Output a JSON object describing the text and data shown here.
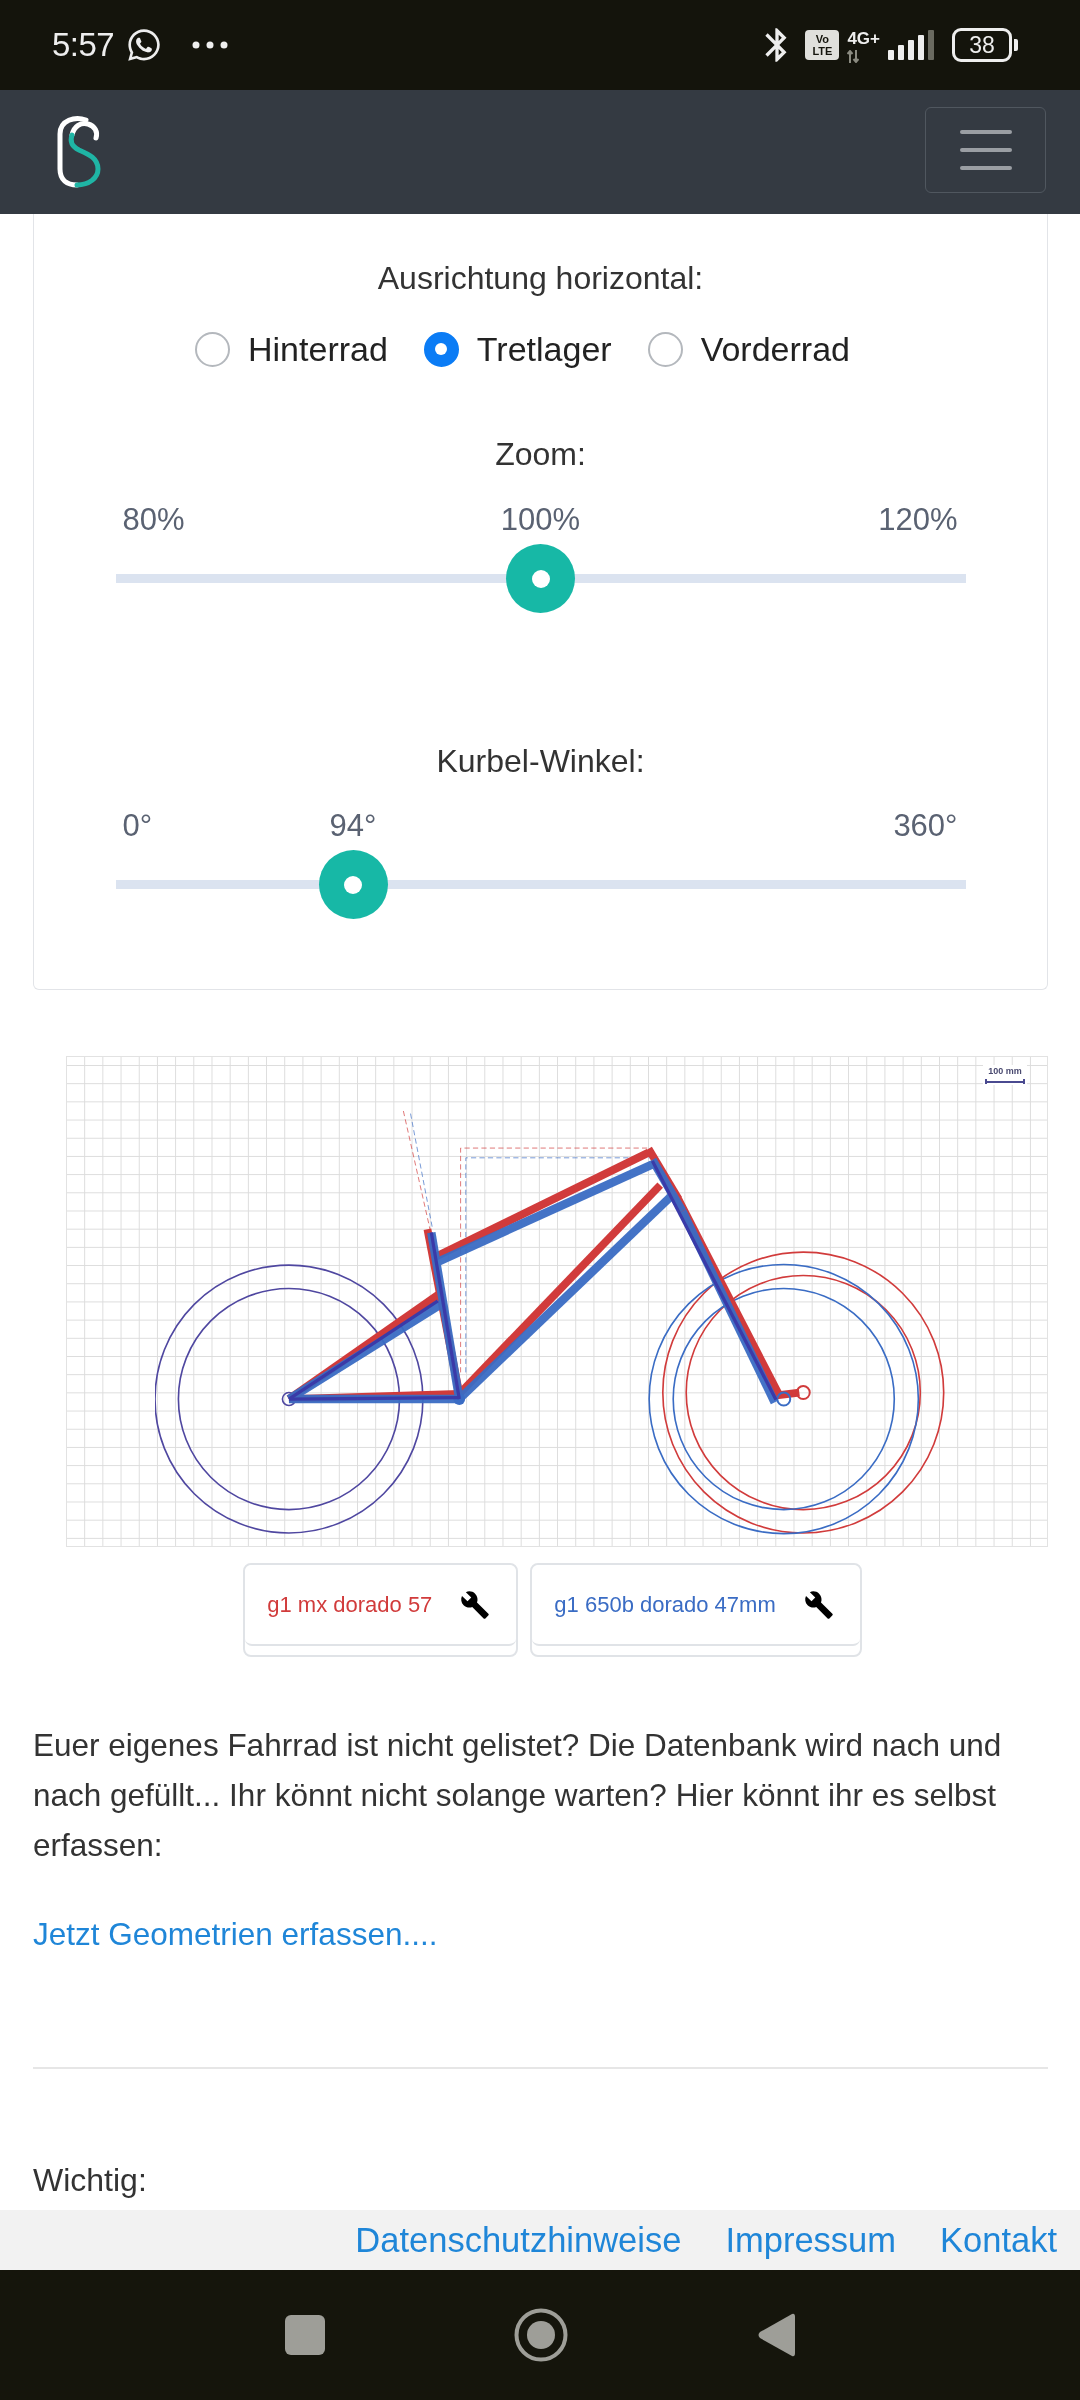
{
  "status_bar": {
    "time": "5:57",
    "volte": "Vo LTE",
    "network": "4G+",
    "battery": "38"
  },
  "alignment": {
    "label": "Ausrichtung horizontal:",
    "options": [
      {
        "label": "Hinterrad",
        "selected": false
      },
      {
        "label": "Tretlager",
        "selected": true
      },
      {
        "label": "Vorderrad",
        "selected": false
      }
    ]
  },
  "sliders": [
    {
      "label": "Zoom:",
      "min": "80%",
      "value": "100%",
      "max": "120%",
      "level": 0.5
    },
    {
      "label": "Kurbel-Winkel:",
      "min": "0°",
      "value": "94°",
      "max": "360°",
      "level": 0.26
    }
  ],
  "chart": {
    "scale": "100 mm"
  },
  "bikes": [
    {
      "name": "g1 mx dorado 57",
      "color": "#d13b3b"
    },
    {
      "name": "g1 650b dorado 47mm",
      "color": "#3a6cc4"
    }
  ],
  "intro": "Euer eigenes Fahrrad ist nicht gelistet? Die Datenbank wird nach und nach gefüllt... Ihr könnt nicht solange warten? Hier könnt ihr es selbst erfassen:",
  "link": "Jetzt Geometrien erfassen....",
  "notice_heading": "Wichtig:",
  "footer_links": [
    "Datenschutzhinweise",
    "Impressum",
    "Kontakt"
  ]
}
